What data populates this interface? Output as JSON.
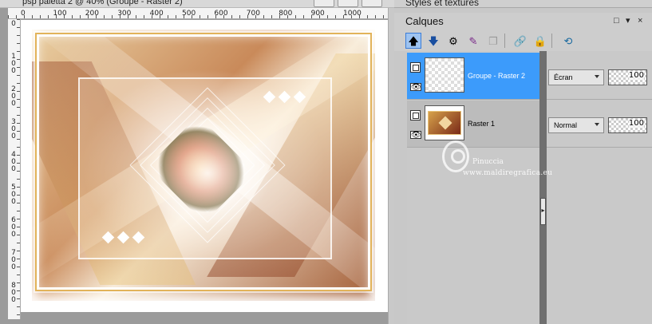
{
  "document": {
    "title": "psp paletta 2 @ 40% (Groupe - Raster 2)",
    "ruler_top_labels": [
      "0",
      "100",
      "200",
      "300",
      "400",
      "500",
      "600",
      "700",
      "800",
      "900",
      "1000"
    ],
    "ruler_left_labels": [
      "0",
      "1\n0\n0",
      "2\n0\n0",
      "3\n0\n0",
      "4\n0\n0",
      "5\n0\n0",
      "6\n0\n0",
      "7\n0\n0",
      "8\n0\n0"
    ]
  },
  "styles_panel": {
    "title": "Styles et textures"
  },
  "layers_panel": {
    "title": "Calques",
    "header_buttons": [
      "□",
      "▾",
      "×"
    ],
    "toolbar_icons": [
      "new-layer-above-icon",
      "new-layer-below-icon",
      "layer-properties-icon",
      "layer-effects-icon",
      "duplicate-layer-icon",
      "link-layers-icon",
      "lock-layer-icon",
      "layer-visibility-icon"
    ],
    "layers": [
      {
        "name": "Groupe - Raster 2",
        "blend_mode": "Écran",
        "opacity": "100",
        "selected": true
      },
      {
        "name": "Raster 1",
        "blend_mode": "Normal",
        "opacity": "100",
        "selected": false
      }
    ]
  },
  "watermark": {
    "name": "Pinuccia",
    "url": "www.maldiregrafica.eu"
  },
  "colors": {
    "selected_layer": "#3c9bfb",
    "panel_bg": "#c8c8c8",
    "divider": "#6f6f6f"
  }
}
